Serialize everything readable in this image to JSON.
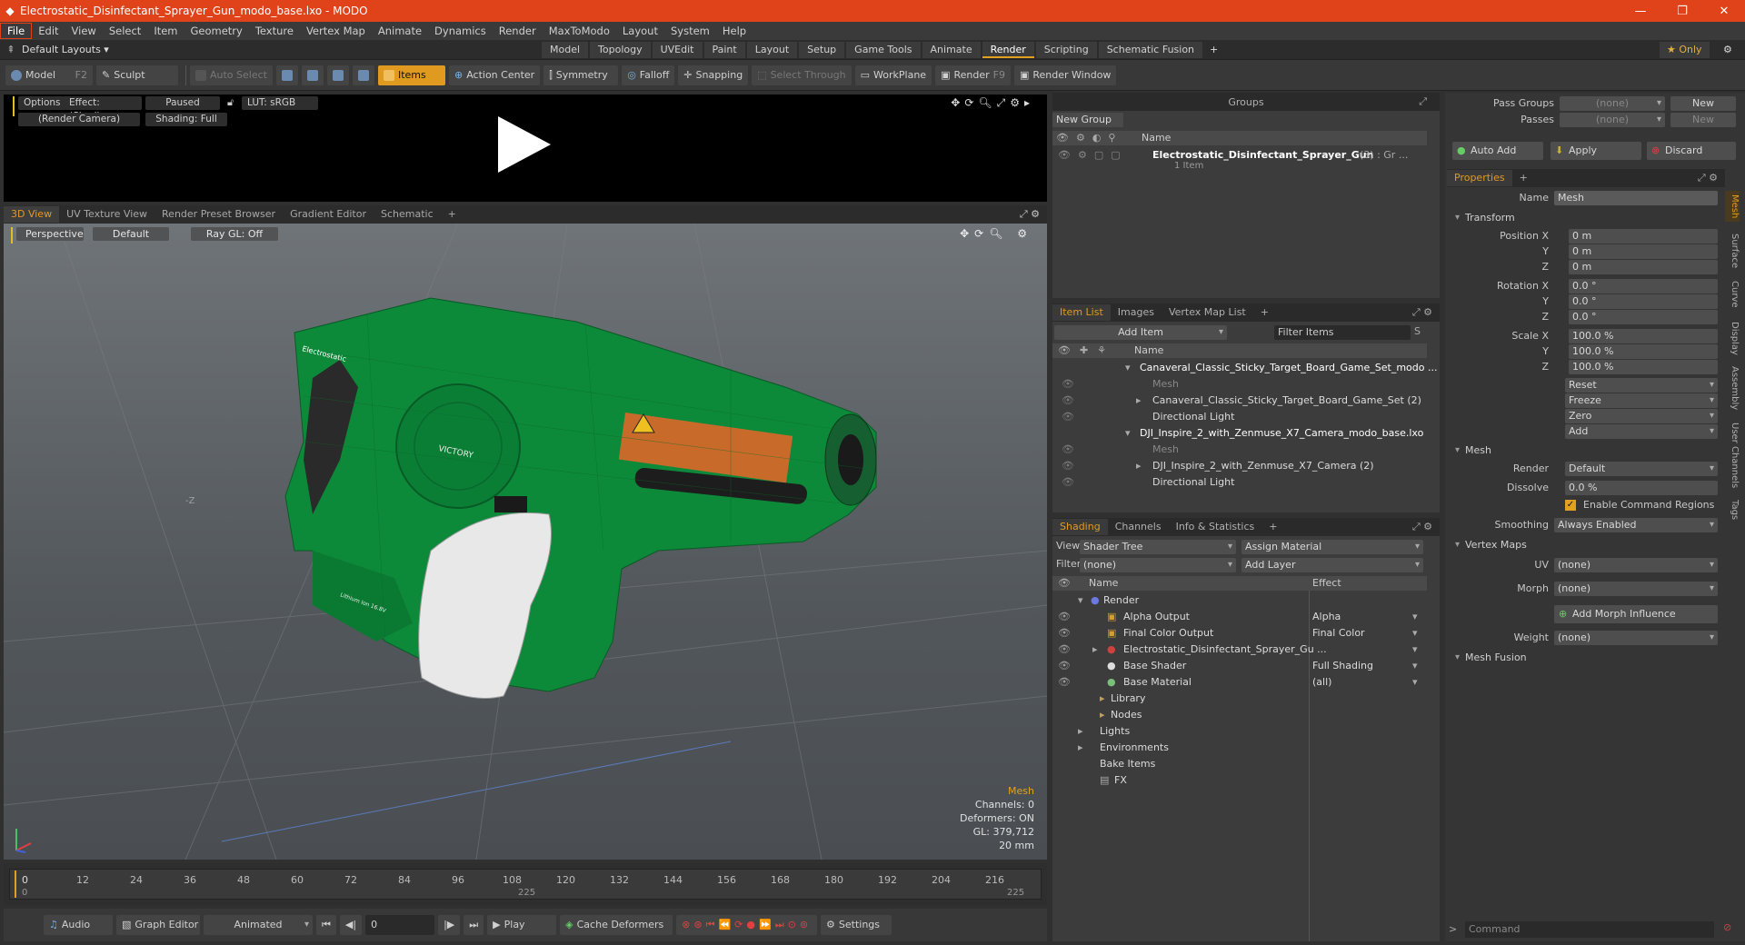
{
  "title": {
    "text": "Electrostatic_Disinfectant_Sprayer_Gun_modo_base.lxo - MODO",
    "controls": [
      "—",
      "❐",
      "✕"
    ]
  },
  "menu": [
    "File",
    "Edit",
    "View",
    "Select",
    "Item",
    "Geometry",
    "Texture",
    "Vertex Map",
    "Animate",
    "Dynamics",
    "Render",
    "MaxToModo",
    "Layout",
    "System",
    "Help"
  ],
  "layout": {
    "preset": "Default Layouts ▾",
    "tabs": [
      "Model",
      "Topology",
      "UVEdit",
      "Paint",
      "Layout",
      "Setup",
      "Game Tools",
      "Animate",
      "Render",
      "Scripting",
      "Schematic Fusion"
    ],
    "active": "Render",
    "plus": "+",
    "only": "★ Only"
  },
  "toolbar": {
    "model": "Model",
    "model_key": "F2",
    "sculpt": "Sculpt",
    "auto_select": "Auto Select",
    "items": "Items",
    "action_center": "Action Center",
    "symmetry": "Symmetry",
    "falloff": "Falloff",
    "snapping": "Snapping",
    "select_through": "Select Through",
    "workplane": "WorkPlane",
    "render": "Render",
    "render_key": "F9",
    "render_window": "Render Window"
  },
  "render_panel": {
    "options": "Options",
    "effect": "Effect: (Shadi...",
    "paused": "Paused",
    "lut": "LUT: sRGB",
    "camera": "(Render Camera)",
    "shading": "Shading: Full"
  },
  "viewport_tabs": [
    "3D View",
    "UV Texture View",
    "Render Preset Browser",
    "Gradient Editor",
    "Schematic",
    "+"
  ],
  "viewport": {
    "perspective": "Perspective",
    "default": "Default",
    "raygl": "Ray GL: Off",
    "axis_label": "-Z",
    "model_brand": "Electrostatic",
    "model_logo": "VICTORY",
    "model_battery": "Lithium Ion 16.8V",
    "info": [
      "Mesh",
      "Channels: 0",
      "Deformers: ON",
      "GL: 379,712",
      "20 mm"
    ]
  },
  "timeline": {
    "ticks": [
      "0",
      "12",
      "24",
      "36",
      "48",
      "60",
      "72",
      "84",
      "96",
      "108",
      "120",
      "132",
      "144",
      "156",
      "168",
      "180",
      "192",
      "204",
      "216"
    ],
    "start": "0",
    "mid": "225",
    "end": "225"
  },
  "bottom": {
    "audio": "Audio",
    "graph_editor": "Graph Editor",
    "animated": "Animated",
    "frame": "0",
    "play": "Play",
    "cache": "Cache Deformers",
    "settings": "Settings"
  },
  "groups": {
    "title": "Groups",
    "new_group": "New Group",
    "col_name": "Name",
    "item_name": "Electrostatic_Disinfectant_Sprayer_Gun",
    "item_count": "(3) : Gr ...",
    "item_sub": "1 Item"
  },
  "itemlist": {
    "tabs": [
      "Item List",
      "Images",
      "Vertex Map List",
      "+"
    ],
    "add_item": "Add Item",
    "filter": "Filter Items",
    "col_name": "Name",
    "rows": [
      "Canaveral_Classic_Sticky_Target_Board_Game_Set_modo ...",
      "Mesh",
      "Canaveral_Classic_Sticky_Target_Board_Game_Set (2)",
      "Directional Light",
      "DJI_Inspire_2_with_Zenmuse_X7_Camera_modo_base.lxo",
      "Mesh",
      "DJI_Inspire_2_with_Zenmuse_X7_Camera (2)",
      "Directional Light"
    ]
  },
  "shading": {
    "tabs": [
      "Shading",
      "Channels",
      "Info & Statistics",
      "+"
    ],
    "view_label": "View",
    "view_val": "Shader Tree",
    "assign": "Assign Material",
    "filter_label": "Filter",
    "filter_val": "(none)",
    "add_layer": "Add Layer",
    "col_name": "Name",
    "col_effect": "Effect",
    "rows": [
      {
        "n": "Render",
        "e": ""
      },
      {
        "n": "Alpha Output",
        "e": "Alpha"
      },
      {
        "n": "Final Color Output",
        "e": "Final Color"
      },
      {
        "n": "Electrostatic_Disinfectant_Sprayer_Gu ...",
        "e": ""
      },
      {
        "n": "Base Shader",
        "e": "Full Shading"
      },
      {
        "n": "Base Material",
        "e": "(all)"
      },
      {
        "n": "Library",
        "e": ""
      },
      {
        "n": "Nodes",
        "e": ""
      },
      {
        "n": "Lights",
        "e": ""
      },
      {
        "n": "Environments",
        "e": ""
      },
      {
        "n": "Bake Items",
        "e": ""
      },
      {
        "n": "FX",
        "e": ""
      }
    ]
  },
  "props": {
    "pass_groups": "Pass Groups",
    "passes": "Passes",
    "none": "(none)",
    "new": "New",
    "auto_add": "Auto Add",
    "apply": "Apply",
    "discard": "Discard",
    "tab": "Properties",
    "plus": "+",
    "name_label": "Name",
    "name_val": "Mesh",
    "transform": "Transform",
    "pos_label": "Position X",
    "rot_label": "Rotation X",
    "scale_label": "Scale X",
    "y": "Y",
    "z": "Z",
    "pos": [
      "0 m",
      "0 m",
      "0 m"
    ],
    "rot": [
      "0.0 °",
      "0.0 °",
      "0.0 °"
    ],
    "scale": [
      "100.0 %",
      "100.0 %",
      "100.0 %"
    ],
    "reset": "Reset",
    "freeze": "Freeze",
    "zero": "Zero",
    "add": "Add",
    "mesh": "Mesh",
    "render_label": "Render",
    "render_val": "Default",
    "dissolve_label": "Dissolve",
    "dissolve_val": "0.0 %",
    "enable_cmd": "Enable Command Regions",
    "smoothing_label": "Smoothing",
    "smoothing_val": "Always Enabled",
    "vertex_maps": "Vertex Maps",
    "uv_label": "UV",
    "morph_label": "Morph",
    "add_morph": "Add Morph Influence",
    "weight_label": "Weight",
    "mesh_fusion": "Mesh Fusion",
    "command": "Command",
    "side_tabs": [
      "Mesh",
      "Surface",
      "Curve",
      "Display",
      "Assembly",
      "User Channels",
      "Tags"
    ]
  }
}
